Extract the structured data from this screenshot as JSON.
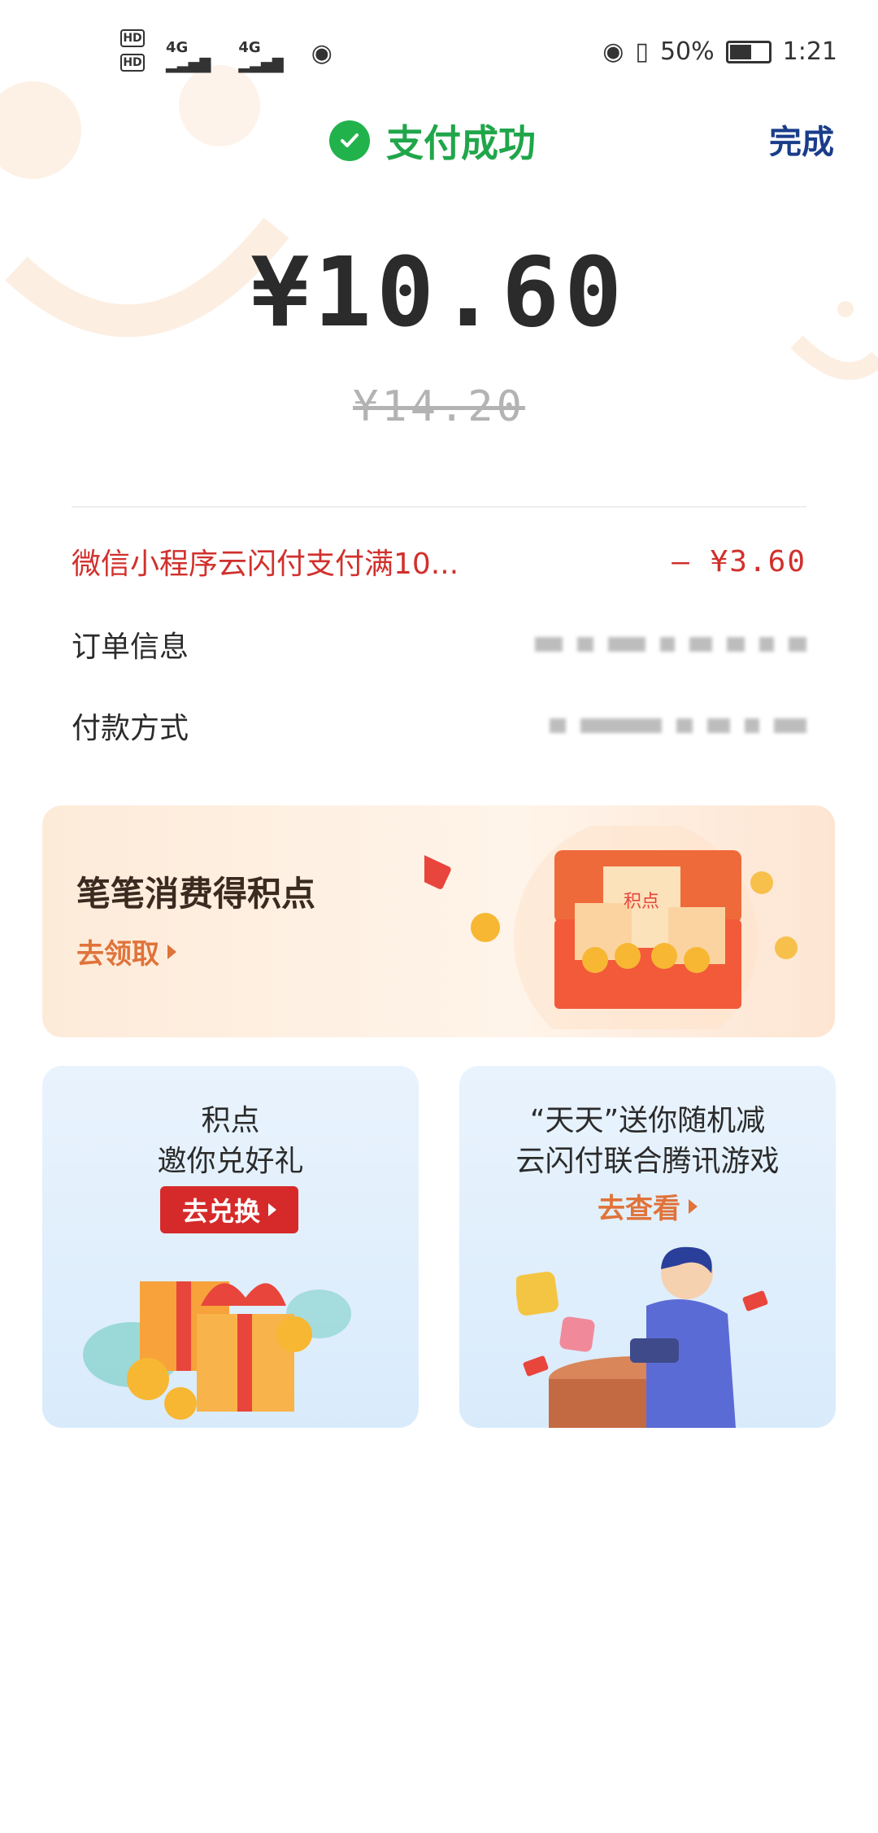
{
  "status_bar": {
    "hd1": "HD",
    "hd2": "HD",
    "net1": "4G",
    "net2": "4G",
    "battery": "50%",
    "time": "1:21"
  },
  "header": {
    "title": "支付成功",
    "done": "完成"
  },
  "payment": {
    "amount": "¥10.60",
    "original_amount": "¥14.20"
  },
  "details": {
    "discount_label": "微信小程序云闪付支付满10...",
    "discount_value": "– ¥3.60",
    "order_label": "订单信息",
    "method_label": "付款方式"
  },
  "banner": {
    "title": "笔笔消费得积点",
    "link": "去领取",
    "box_label": "积点"
  },
  "card_left": {
    "line1": "积点",
    "line2": "邀你兑好礼",
    "button": "去兑换"
  },
  "card_right": {
    "line1": "“天天”送你随机减",
    "line2": "云闪付联合腾讯游戏",
    "link": "去查看"
  },
  "colors": {
    "success_green": "#22b24c",
    "discount_red": "#d1302c",
    "accent_orange": "#e0733a",
    "done_blue": "#1a3d8a"
  }
}
